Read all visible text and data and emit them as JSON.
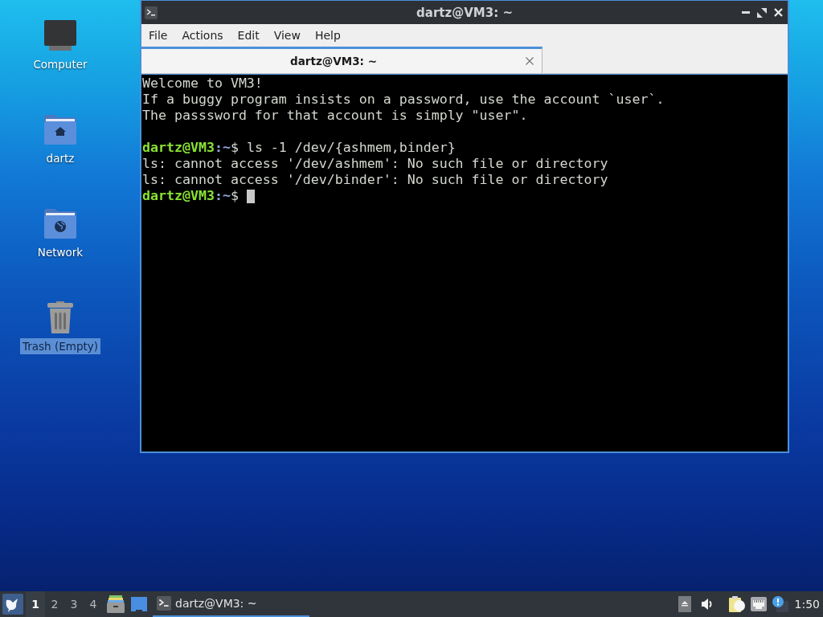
{
  "desktop_icons": [
    {
      "kind": "computer",
      "label": "Computer",
      "selected": false
    },
    {
      "kind": "home",
      "label": "dartz",
      "selected": false
    },
    {
      "kind": "network",
      "label": "Network",
      "selected": false
    },
    {
      "kind": "trash",
      "label": "Trash (Empty)",
      "selected": true
    }
  ],
  "window": {
    "title": "dartz@VM3: ~",
    "menu": [
      "File",
      "Actions",
      "Edit",
      "View",
      "Help"
    ],
    "tabs": [
      {
        "label": "dartz@VM3: ~",
        "selected": true
      }
    ],
    "terminal": {
      "lines": [
        {
          "kind": "text",
          "segments": [
            {
              "text": "Welcome to VM3!",
              "kind": "plain"
            }
          ]
        },
        {
          "kind": "text",
          "segments": [
            {
              "text": "If a buggy program insists on a password, use the account `user`.",
              "kind": "plain"
            }
          ]
        },
        {
          "kind": "text",
          "segments": [
            {
              "text": "The passsword for that account is simply \"user\".",
              "kind": "plain"
            }
          ]
        },
        {
          "kind": "blank"
        },
        {
          "kind": "text",
          "segments": [
            {
              "text": "dartz@VM3",
              "kind": "user"
            },
            {
              "text": ":~",
              "kind": "path"
            },
            {
              "text": "$ ls -1 /dev/{ashmem,binder}",
              "kind": "plain"
            }
          ]
        },
        {
          "kind": "text",
          "segments": [
            {
              "text": "ls: cannot access '/dev/ashmem': No such file or directory",
              "kind": "plain"
            }
          ]
        },
        {
          "kind": "text",
          "segments": [
            {
              "text": "ls: cannot access '/dev/binder': No such file or directory",
              "kind": "plain"
            }
          ]
        },
        {
          "kind": "text",
          "segments": [
            {
              "text": "dartz@VM3",
              "kind": "user"
            },
            {
              "text": ":~",
              "kind": "path"
            },
            {
              "text": "$",
              "kind": "plain"
            }
          ]
        }
      ],
      "cursor": true
    }
  },
  "taskbar": {
    "workspaces": [
      {
        "label": "1",
        "selected": true
      },
      {
        "label": "2",
        "selected": false
      },
      {
        "label": "3",
        "selected": false
      },
      {
        "label": "4",
        "selected": false
      }
    ],
    "tasks": [
      {
        "label": "dartz@VM3: ~",
        "selected": true
      }
    ],
    "clock": "1:50"
  }
}
